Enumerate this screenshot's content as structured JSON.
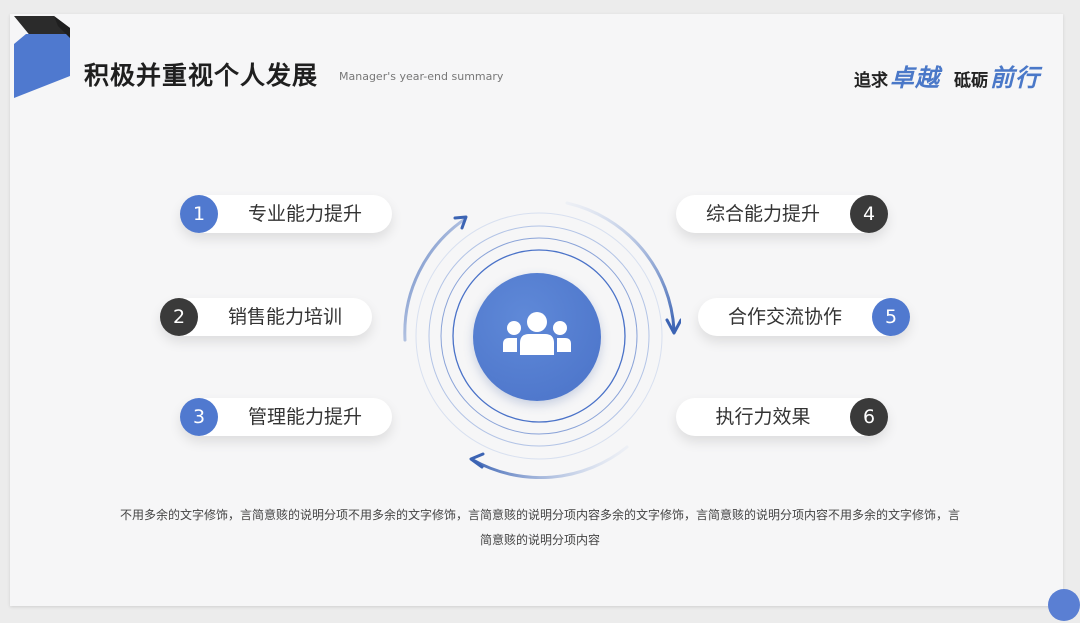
{
  "header": {
    "title": "积极并重视个人发展",
    "subtitle": "Manager's year-end summary",
    "slogan": [
      {
        "prefix": "追求",
        "emphasis": "卓越"
      },
      {
        "prefix": "砥砺",
        "emphasis": "前行"
      }
    ]
  },
  "center": {
    "icon": "team-icon"
  },
  "items": [
    {
      "number": "1",
      "label": "专业能力提升"
    },
    {
      "number": "2",
      "label": "销售能力培训"
    },
    {
      "number": "3",
      "label": "管理能力提升"
    },
    {
      "number": "4",
      "label": "综合能力提升"
    },
    {
      "number": "5",
      "label": "合作交流协作"
    },
    {
      "number": "6",
      "label": "执行力效果"
    }
  ],
  "description": "不用多余的文字修饰，言简意赅的说明分项不用多余的文字修饰，言简意赅的说明分项内容多余的文字修饰，言简意赅的说明分项内容不用多余的文字修饰，言简意赅的说明分项内容",
  "colors": {
    "accent": "#5079cf",
    "dark": "#3a3a3a",
    "logo_dark": "#2b2b2b"
  }
}
